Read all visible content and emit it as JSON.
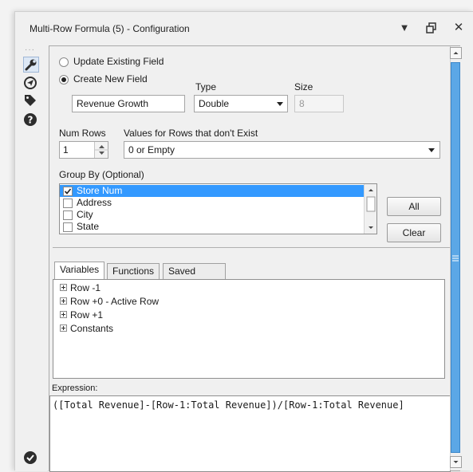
{
  "window": {
    "title": "Multi-Row Formula (5) - Configuration"
  },
  "titlebar": {
    "dropdown_icon": "triangle-down-icon",
    "restore_icon": "restore-icon",
    "close_icon": "close-icon"
  },
  "toolbar": {
    "items": [
      {
        "name": "wrench-icon"
      },
      {
        "name": "navigate-icon"
      },
      {
        "name": "tag-icon"
      },
      {
        "name": "help-icon"
      }
    ],
    "status_icon": "check-circle-icon"
  },
  "field_mode": {
    "update_label": "Update Existing Field",
    "create_label": "Create New  Field",
    "selected": "create"
  },
  "new_field": {
    "name_value": "Revenue Growth",
    "type_label": "Type",
    "type_value": "Double",
    "size_label": "Size",
    "size_value": "8"
  },
  "rows": {
    "num_rows_label": "Num Rows",
    "num_rows_value": "1",
    "values_label": "Values for Rows that don't Exist",
    "values_value": "0 or Empty"
  },
  "group_by": {
    "label": "Group By (Optional)",
    "items": [
      {
        "label": "Store Num",
        "checked": true,
        "selected": true
      },
      {
        "label": "Address",
        "checked": false,
        "selected": false
      },
      {
        "label": "City",
        "checked": false,
        "selected": false
      },
      {
        "label": "State",
        "checked": false,
        "selected": false
      }
    ],
    "all_button": "All",
    "clear_button": "Clear"
  },
  "tabs": [
    {
      "label": "Variables",
      "active": true
    },
    {
      "label": "Functions",
      "active": false
    },
    {
      "label": "Saved Expressions",
      "active": false
    }
  ],
  "variables_tree": [
    {
      "label": "Row -1"
    },
    {
      "label": "Row +0 - Active Row"
    },
    {
      "label": "Row +1"
    },
    {
      "label": "Constants"
    }
  ],
  "expression": {
    "label": "Expression:",
    "text": "([Total Revenue]-[Row-1:Total Revenue])/[Row-1:Total Revenue]"
  },
  "colors": {
    "selection": "#3399ff",
    "border": "#a9a9a9",
    "accent_text": "#1a1a1a"
  }
}
